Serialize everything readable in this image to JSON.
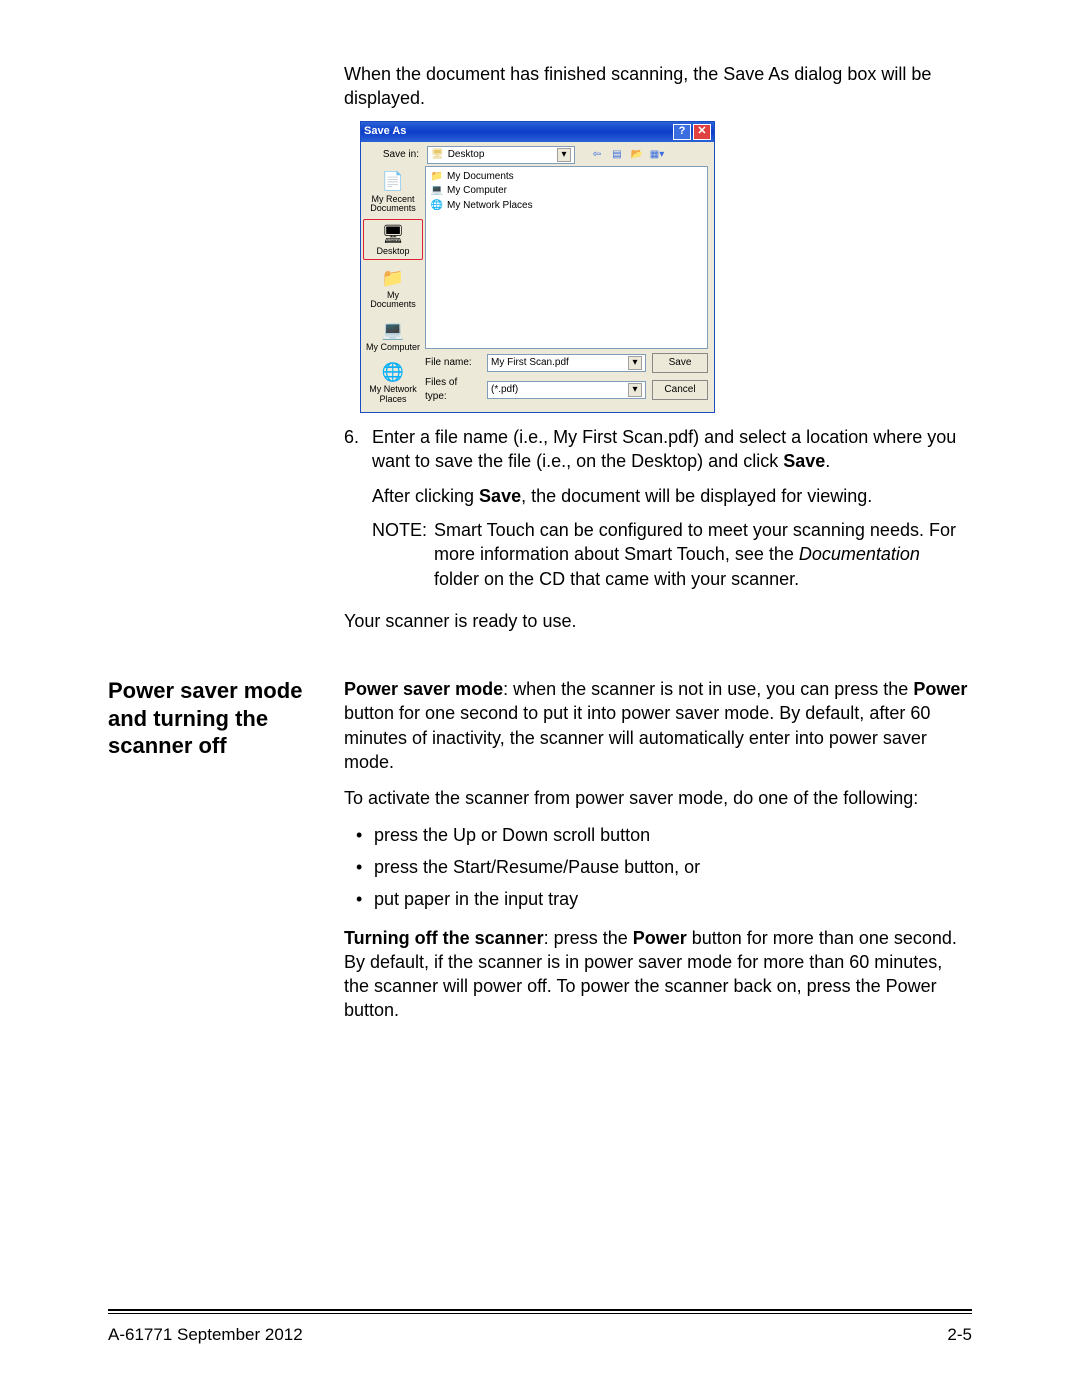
{
  "intro": "When the document has finished scanning, the Save As dialog box will be displayed.",
  "dialog": {
    "title": "Save As",
    "help": "?",
    "close": "✕",
    "savein_label": "Save in:",
    "savein_value": "Desktop",
    "nav_back": "⇦",
    "nav_up": "▤",
    "nav_new": "📂",
    "nav_views": "▦▾",
    "places": {
      "recent": "My Recent Documents",
      "desktop": "Desktop",
      "mydocs": "My Documents",
      "mycomp": "My Computer",
      "netplaces": "My Network Places"
    },
    "filelist": {
      "mydocs": "My Documents",
      "mycomp": "My Computer",
      "netplaces": "My Network Places"
    },
    "filename_label": "File name:",
    "filename_value": "My First Scan.pdf",
    "filetype_label": "Files of type:",
    "filetype_value": "(*.pdf)",
    "save_btn": "Save",
    "cancel_btn": "Cancel"
  },
  "step6": {
    "num": "6.",
    "text_a": "Enter a file name (i.e., My First Scan.pdf) and select a location where you want to save the file (i.e., on the Desktop) and click ",
    "save_bold": "Save",
    "text_b": "."
  },
  "sub": {
    "a": "After clicking ",
    "b": "Save",
    "c": ", the document will be displayed for viewing."
  },
  "note": {
    "label": "NOTE:",
    "a": "Smart Touch can be configured to meet your scanning needs. For more information about Smart Touch, see the ",
    "b": "Documentation",
    "c": " folder on the CD that came with your scanner."
  },
  "ready": "Your scanner is ready to use.",
  "section2": {
    "heading": "Power saver mode and turning the scanner off",
    "p1": {
      "a": "Power saver mode",
      "b": ": when the scanner is not in use, you can press the ",
      "c": "Power",
      "d": " button for one second to put it into power saver mode. By default, after 60 minutes of inactivity, the scanner will automatically enter into power saver mode."
    },
    "p2": "To activate the scanner from power saver mode, do one of the following:",
    "bullets": {
      "b1": "press the Up or Down scroll button",
      "b2": "press the Start/Resume/Pause button, or",
      "b3": "put paper in the input tray"
    },
    "p3": {
      "a": "Turning off the scanner",
      "b": ": press the ",
      "c": "Power",
      "d": " button for more than one second. By default, if the scanner is in power saver mode for more than 60 minutes, the scanner will power off. To power the scanner back on, press the Power button."
    }
  },
  "footer": {
    "left": "A-61771   September 2012",
    "right": "2-5"
  }
}
